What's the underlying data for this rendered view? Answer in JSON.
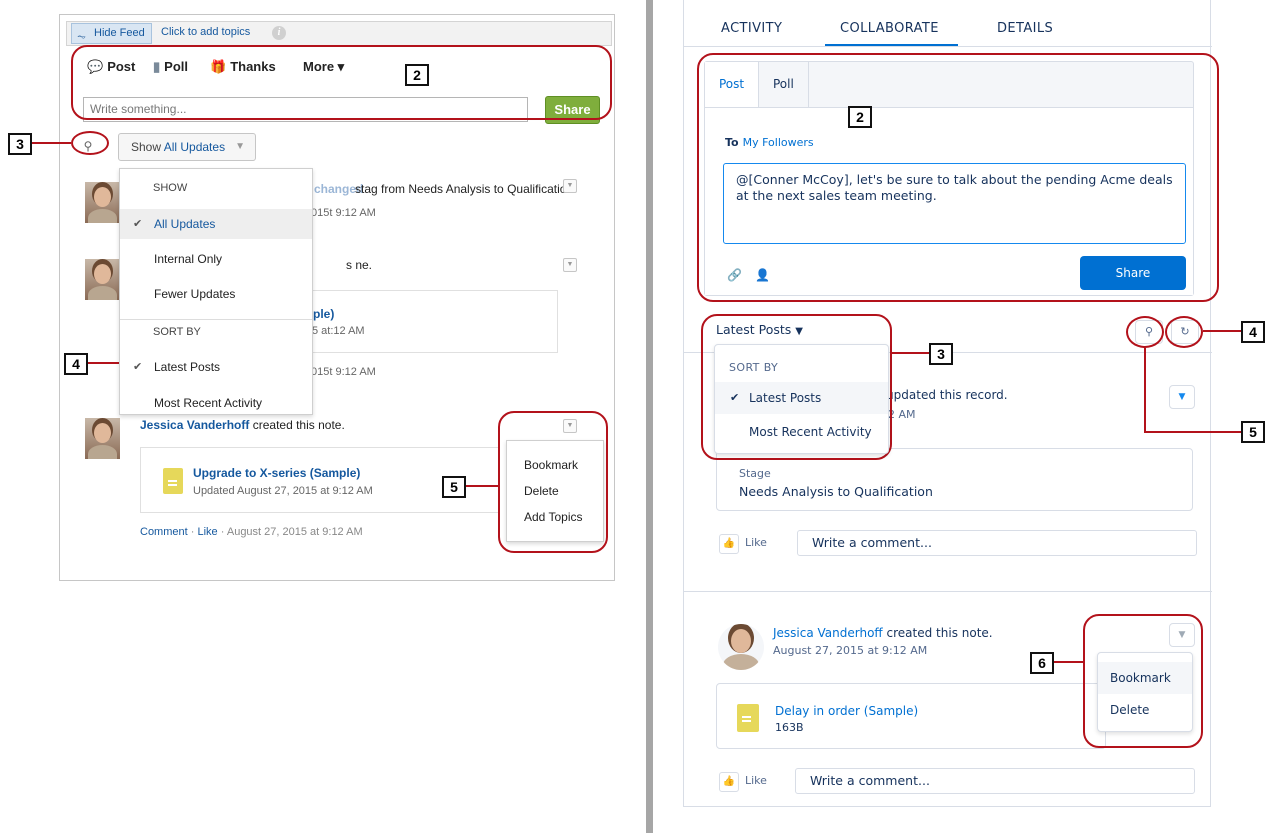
{
  "classic": {
    "topbar": {
      "hide_feed": "Hide Feed",
      "add_topics": "Click to add topics",
      "info_icon": "i"
    },
    "publisher": {
      "tabs": {
        "post": "Post",
        "poll": "Poll",
        "thanks": "Thanks",
        "more": "More ▾"
      },
      "placeholder": "Write something...",
      "share": "Share"
    },
    "filter": {
      "show": "Show",
      "value": "All Updates"
    },
    "menu": {
      "show_header": "SHOW",
      "show_items": [
        "All Updates",
        "Internal Only",
        "Fewer Updates"
      ],
      "sort_header": "SORT BY",
      "sort_items": [
        "Latest Posts",
        "Most Recent Activity"
      ]
    },
    "feed": {
      "item1_partial_name": "Vanderhoff changed",
      "item1_text": "stag from Needs Analysis to Qualification.",
      "item1_time": "015t 9:12 AM",
      "item2_text": "s ne.",
      "item2_attach_title": "ple)",
      "item2_attach_time": "5 at:12 AM",
      "item2_time": "015t 9:12 AM",
      "item3_name": "Jessica Vanderhoff",
      "item3_action": "created this note.",
      "item3_attach_title": "Upgrade to X-series (Sample)",
      "item3_attach_time": "Updated August 27, 2015 at 9:12 AM",
      "comment": "Comment",
      "like": "Like",
      "sep": "·",
      "item3_time": "August 27, 2015 at 9:12 AM"
    },
    "action_menu": [
      "Bookmark",
      "Delete",
      "Add Topics"
    ]
  },
  "lightning": {
    "tabs": [
      "ACTIVITY",
      "COLLABORATE",
      "DETAILS"
    ],
    "publisher": {
      "tabs": [
        "Post",
        "Poll"
      ],
      "to_label": "To",
      "to_value": "My Followers",
      "text": "@[Conner McCoy], let's be sure to talk about the pending Acme deals at the next sales team meeting.",
      "share": "Share"
    },
    "sort": {
      "label": "Latest Posts",
      "header": "SORT BY",
      "items": [
        "Latest Posts",
        "Most Recent Activity"
      ]
    },
    "post1": {
      "text": "f updated this record.",
      "time": "2 AM",
      "field_label": "Stage",
      "field_value": "Needs Analysis to Qualification",
      "like": "Like",
      "comment_placeholder": "Write a comment..."
    },
    "post2": {
      "name": "Jessica Vanderhoff",
      "action": "created this note.",
      "time": "August 27, 2015 at 9:12 AM",
      "attach_title": "Delay in order (Sample)",
      "attach_size": "163B",
      "like": "Like",
      "comment_placeholder": "Write a comment..."
    },
    "action_menu": [
      "Bookmark",
      "Delete"
    ]
  },
  "callouts": {
    "left": [
      "2",
      "3",
      "4",
      "5"
    ],
    "right": [
      "2",
      "3",
      "4",
      "5",
      "6"
    ]
  },
  "colors": {
    "callout_ring": "#b3121b",
    "classic_share": "#7fae3c",
    "lightning_brand": "#0070d2",
    "divider": "#a6a6a6"
  }
}
